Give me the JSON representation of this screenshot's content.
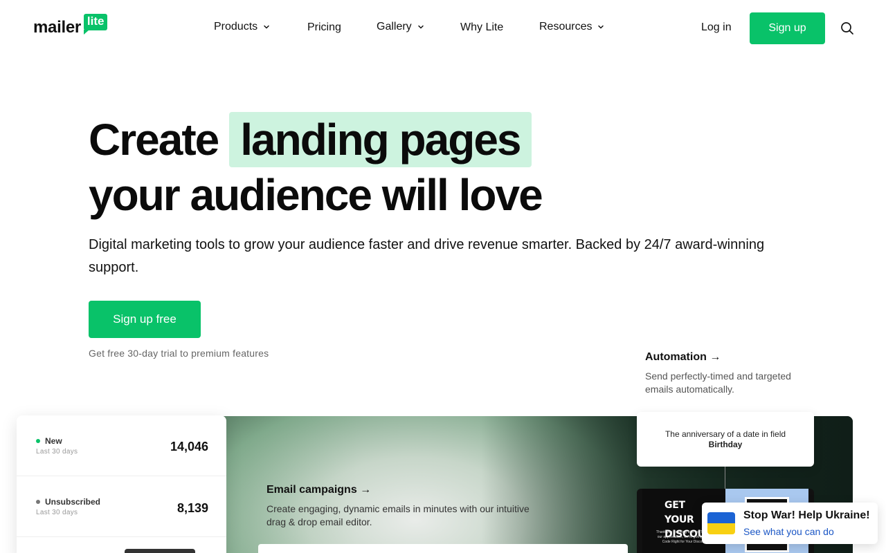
{
  "brand": {
    "name": "mailer",
    "badge": "lite",
    "accent": "#09c269"
  },
  "nav": {
    "items": [
      {
        "label": "Products",
        "dropdown": true
      },
      {
        "label": "Pricing",
        "dropdown": false
      },
      {
        "label": "Gallery",
        "dropdown": true
      },
      {
        "label": "Why Lite",
        "dropdown": false
      },
      {
        "label": "Resources",
        "dropdown": true
      }
    ],
    "login": "Log in",
    "signup": "Sign up",
    "search_icon": "search-icon"
  },
  "hero": {
    "lead": "Create",
    "highlight": "landing pages",
    "line2": "your audience will love",
    "subtitle": "Digital marketing tools to grow your audience faster and drive revenue smarter. Backed by 24/7 award-winning support.",
    "cta": "Sign up free",
    "trial_note": "Get free 30-day trial to premium features",
    "highlight_color": "#cdf3df"
  },
  "automation": {
    "title": "Automation →",
    "desc": "Send perfectly-timed and targeted emails automatically.",
    "trigger_text": "The anniversary of a date in field",
    "trigger_field": "Birthday",
    "thumb_heading": "GET YOUR DISCOUNT",
    "thumb_small": "Thank you for being with us. To show our appreciation, we're giving you a Code Right for Your Discount"
  },
  "campaigns": {
    "title": "Email campaigns →",
    "desc": "Create engaging, dynamic emails in minutes with our intuitive drag & drop email editor."
  },
  "stats": [
    {
      "label": "New",
      "sub": "Last 30 days",
      "value": "14,046",
      "dot_color": "#09c269"
    },
    {
      "label": "Unsubscribed",
      "sub": "Last 30 days",
      "value": "8,139",
      "dot_color": "#777777"
    }
  ],
  "ukraine": {
    "title": "Stop War! Help Ukraine!",
    "link": "See what you can do",
    "flag_blue": "#1b63d4",
    "flag_yellow": "#f8d012"
  }
}
